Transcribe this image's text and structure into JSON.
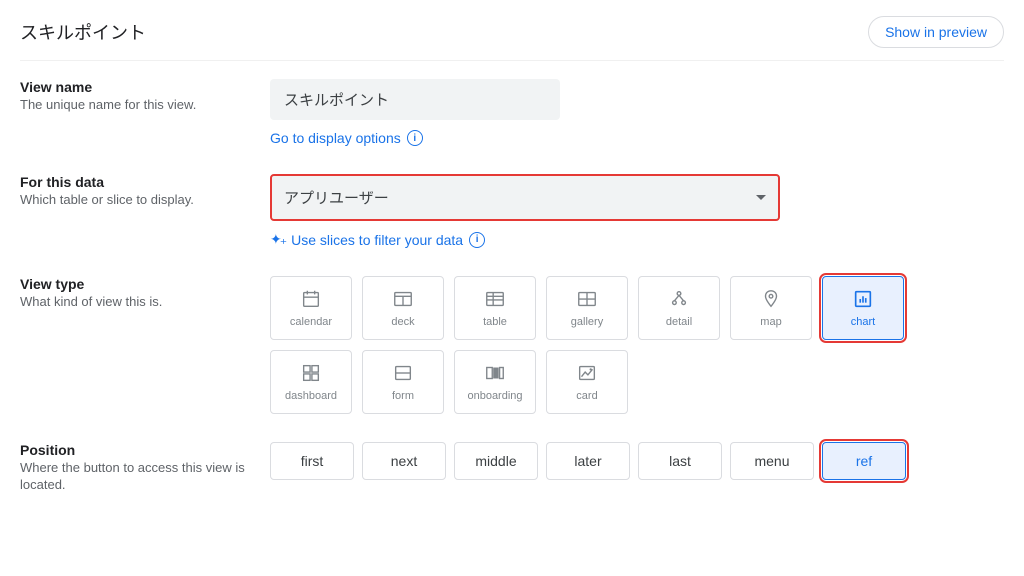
{
  "header": {
    "title": "スキルポイント",
    "show_preview": "Show in preview"
  },
  "view_name": {
    "label": "View name",
    "desc": "The unique name for this view.",
    "value": "スキルポイント",
    "link": "Go to display options"
  },
  "for_this_data": {
    "label": "For this data",
    "desc": "Which table or slice to display.",
    "value": "アプリユーザー",
    "link": "Use slices to filter your data"
  },
  "view_type": {
    "label": "View type",
    "desc": "What kind of view this is.",
    "items": {
      "calendar": "calendar",
      "deck": "deck",
      "table": "table",
      "gallery": "gallery",
      "detail": "detail",
      "map": "map",
      "chart": "chart",
      "dashboard": "dashboard",
      "form": "form",
      "onboarding": "onboarding",
      "card": "card"
    }
  },
  "position": {
    "label": "Position",
    "desc": "Where the button to access this view is located.",
    "items": {
      "first": "first",
      "next": "next",
      "middle": "middle",
      "later": "later",
      "last": "last",
      "menu": "menu",
      "ref": "ref"
    }
  }
}
